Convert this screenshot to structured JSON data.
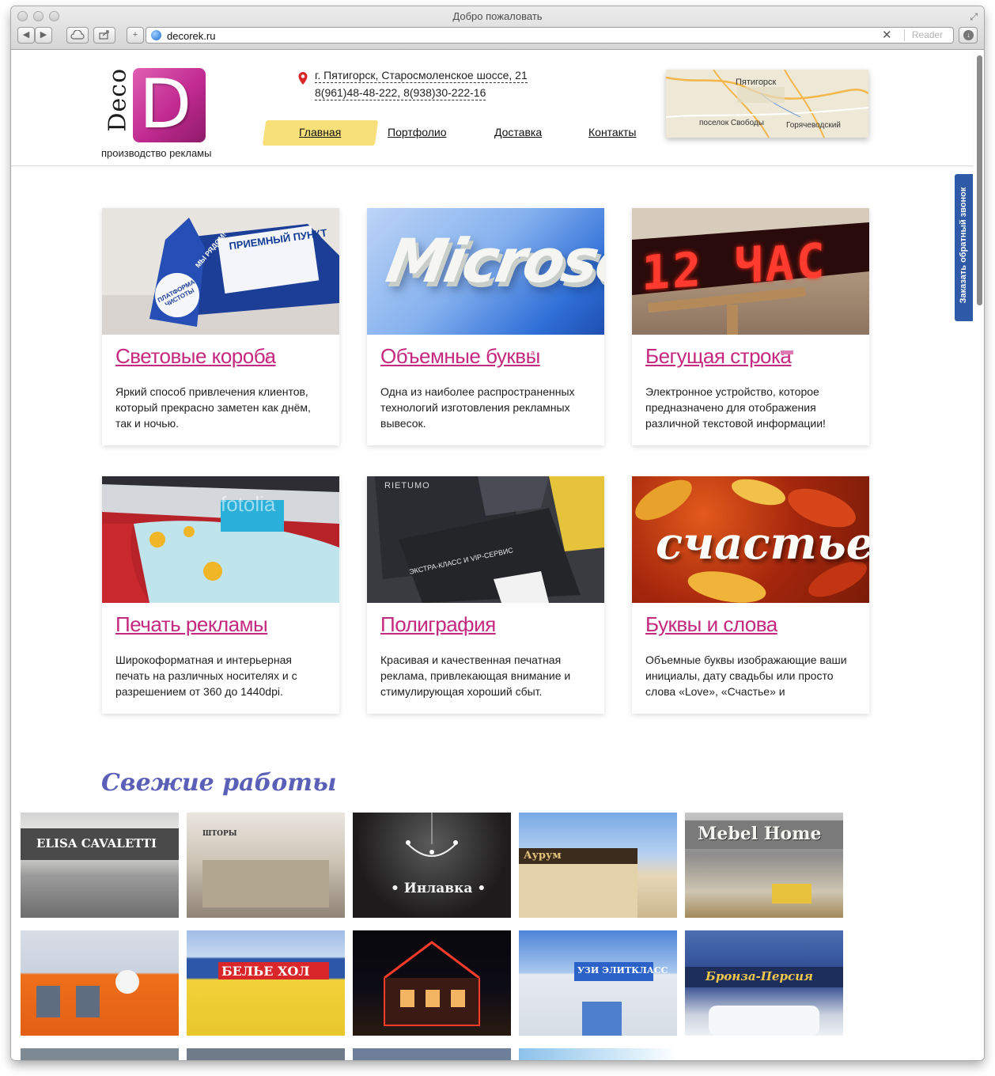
{
  "browser": {
    "window_title": "Добро пожаловать",
    "url": "decorek.ru",
    "reader_label": "Reader",
    "back_label": "◀",
    "forward_label": "▶",
    "add_label": "+"
  },
  "header": {
    "logo": {
      "deco": "Deco",
      "letter": "D",
      "tagline": "производство рекламы"
    },
    "address": "г. Пятигорск, Старосмоленское шоссе, 21",
    "phones": "8(961)48-48-222, 8(938)30-222-16",
    "nav": [
      {
        "label": "Главная",
        "active": true
      },
      {
        "label": "Портфолио",
        "active": false
      },
      {
        "label": "Доставка",
        "active": false
      },
      {
        "label": "Контакты",
        "active": false
      }
    ],
    "map": {
      "city": "Пятигорск",
      "village": "поселок Свободы",
      "town": "Горячеводский"
    },
    "callback_label": "Заказать обратный звонок"
  },
  "services": [
    {
      "title": "Световые короба",
      "text": "Яркий способ привлечения клиентов, который прекрасно заметен как днём, так и ночью."
    },
    {
      "title": "Объемные буквы",
      "text": "Одна из наиболее распространенных технологий изготовления рекламных вывесок."
    },
    {
      "title": "Бегущая строка",
      "text": "Электронное устройство, которое предназначено для отображения различной текстовой информации!"
    },
    {
      "title": "Печать рекламы",
      "text": "Широкоформатная и интерьерная печать на различных носителях и с разрешением от 360 до 1440dpi."
    },
    {
      "title": "Полиграфия",
      "text": "Красивая и качественная печатная реклама, привлекающая внимание и стимулирующая хороший сбыт."
    },
    {
      "title": "Буквы и слова",
      "text": "Объемные буквы изображающие ваши инициалы, дату свадьбы или просто слова «Love», «Счастье» и"
    }
  ],
  "service_images": {
    "lightbox": {
      "line1": "ПРИЕМНЫЙ ПУНКТ",
      "line2": "МЫ РЯДОМ!",
      "line3": "ПЛАТФОРМА ЧИСТОТЫ"
    },
    "letters": "Microso",
    "ticker": "12 ЧАС",
    "print": "fotolia",
    "brochure": {
      "brand": "RIETUMO",
      "text": "ЭКСТРА-КЛАСС И VIP-СЕРВИС"
    },
    "word": "счастье"
  },
  "fresh_works": {
    "title": "Свежие работы",
    "items": [
      {
        "caption": "ELISA CAVALETTI"
      },
      {
        "caption": "ШТОРЫ"
      },
      {
        "caption": "• Инлавка •"
      },
      {
        "caption": "Аурум"
      },
      {
        "caption": "Mebel Home"
      },
      {
        "caption": ""
      },
      {
        "caption": "БЕЛЬЕ  ХОЛ"
      },
      {
        "caption": ""
      },
      {
        "caption": "УЗИ ЭЛИТКЛАСС"
      },
      {
        "caption": "Бронза-Персия"
      }
    ]
  },
  "colors": {
    "accent": "#c4287f",
    "nav_highlight": "#f7e07a",
    "section_title": "#5a5fb8",
    "callback": "#2f5aa8"
  }
}
